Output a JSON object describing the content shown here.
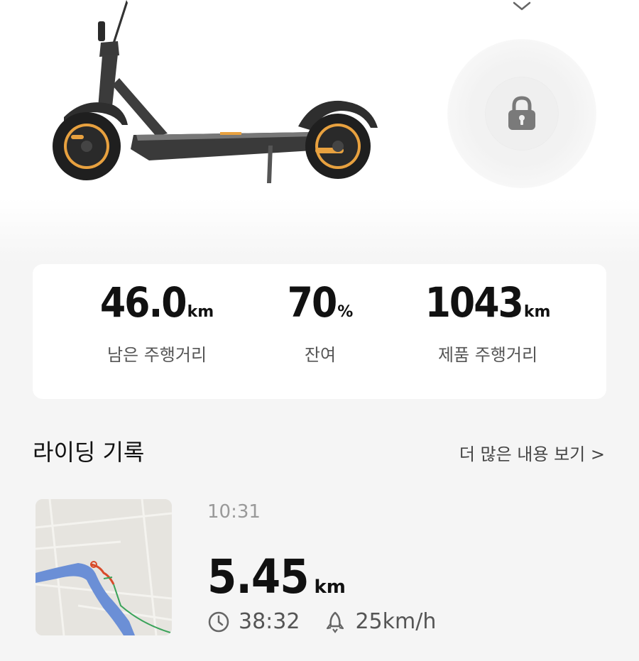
{
  "hero": {
    "scooter_image": "kick-scooter-image",
    "collapse_icon": "chevron-down-icon",
    "lock_icon": "lock-icon"
  },
  "stats": [
    {
      "value": "46.0",
      "unit": "km",
      "label": "남은 주행거리"
    },
    {
      "value": "70",
      "unit": "%",
      "label": "잔여"
    },
    {
      "value": "1043",
      "unit": "km",
      "label": "제품 주행거리"
    }
  ],
  "rides": {
    "title": "라이딩 기록",
    "more_label": "더 많은 내용 보기 >",
    "latest": {
      "time": "10:31",
      "distance": "5.45",
      "distance_unit": "km",
      "duration": "38:32",
      "top_speed": "25km/h",
      "duration_icon": "clock-icon",
      "speed_icon": "rocket-icon",
      "map_icon": "route-map-thumbnail"
    }
  },
  "colors": {
    "accent_orange": "#e8a13f",
    "route_red": "#d84a2a",
    "route_green": "#3aa35a",
    "river_blue": "#6b8fd6"
  }
}
